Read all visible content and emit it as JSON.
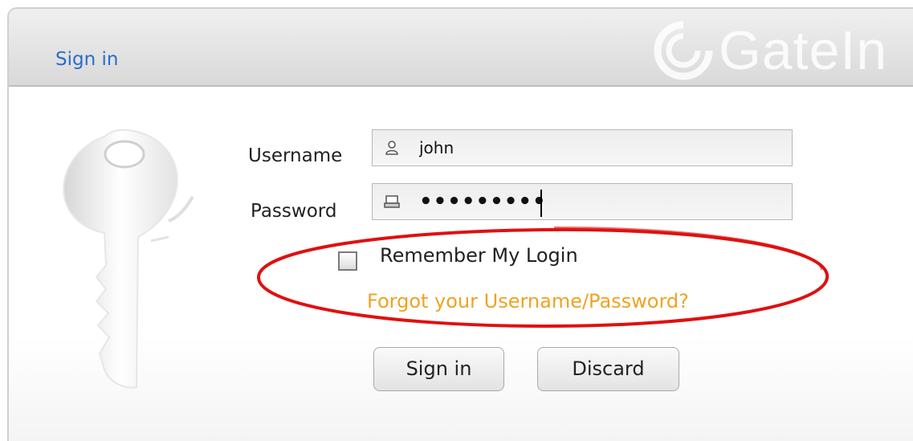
{
  "dialog": {
    "title": "Sign in",
    "brand": "GateIn"
  },
  "form": {
    "username": {
      "label": "Username",
      "value": "john",
      "icon": "user-icon"
    },
    "password": {
      "label": "Password",
      "value": "•••••••••",
      "icon": "keyboard-icon"
    },
    "remember": {
      "label": "Remember My Login",
      "checked": false
    },
    "forgot_link": "Forgot your Username/Password?"
  },
  "buttons": {
    "sign_in": "Sign in",
    "discard": "Discard"
  },
  "colors": {
    "title": "#2a6dc8",
    "link": "#f0a223",
    "annotation": "#e01010"
  }
}
